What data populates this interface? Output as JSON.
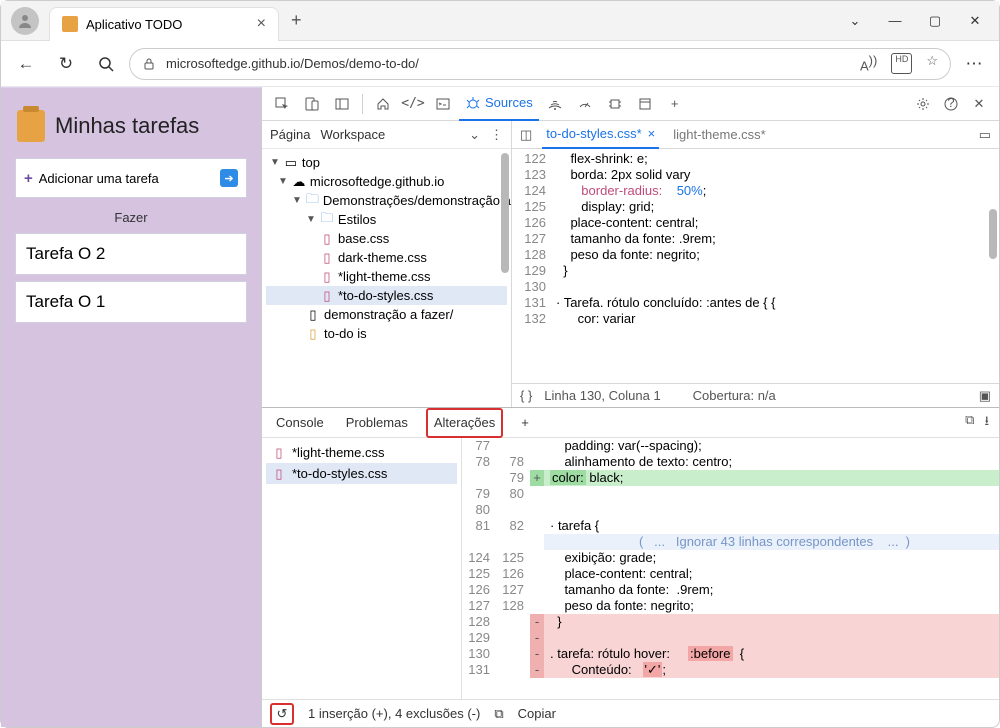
{
  "tab_title": "Aplicativo TODO",
  "url": "microsoftedge.github.io/Demos/demo-to-do/",
  "app": {
    "title": "Minhas tarefas",
    "add_label": "Adicionar uma tarefa",
    "section": "Fazer",
    "tasks": [
      "Tarefa O 2",
      "Tarefa O 1"
    ]
  },
  "dt": {
    "sources_label": "Sources",
    "left_tabs": {
      "pagina": "Página",
      "workspace": "Workspace"
    },
    "tree": {
      "top": "top",
      "domain": "microsoftedge.github.io",
      "demos": "Demonstrações/demonstração a fazer",
      "estilos": "Estilos",
      "files": [
        "base.css",
        "dark-theme.css",
        "*light-theme.css",
        "*to-do-styles.css"
      ],
      "demo2": "demonstração a fazer/",
      "todojs": "to-do is"
    },
    "open_tabs": [
      "to-do-styles.css*",
      "light-theme.css*"
    ],
    "editor_lines": [
      {
        "n": "122",
        "t": "    flex-shrink: e;"
      },
      {
        "n": "123",
        "t": "    borda: 2px solid vary"
      },
      {
        "n": "124",
        "t": "       border-radius:    50%;"
      },
      {
        "n": "125",
        "t": "       display: grid;"
      },
      {
        "n": "126",
        "t": "    place-content: central;"
      },
      {
        "n": "127",
        "t": "    tamanho da fonte: .9rem;"
      },
      {
        "n": "128",
        "t": "    peso da fonte: negrito;"
      },
      {
        "n": "129",
        "t": "  }"
      },
      {
        "n": "130",
        "t": ""
      },
      {
        "n": "131",
        "t": "· Tarefa. rótulo concluído: :antes de { {"
      },
      {
        "n": "132",
        "t": "      cor: variar"
      }
    ],
    "status": {
      "braces": "{ }",
      "pos": "Linha 130, Coluna 1",
      "cov": "Cobertura: n/a"
    },
    "drawer_tabs": {
      "console": "Console",
      "problemas": "Problemas",
      "alteracoes": "Alterações"
    },
    "drawer_files": [
      "*light-theme.css",
      "*to-do-styles.css"
    ],
    "diff": [
      {
        "l": "77",
        "r": "",
        "s": "",
        "t": "    padding: var(--spacing);",
        "cls": ""
      },
      {
        "l": "78",
        "r": "78",
        "s": "",
        "t": "    alinhamento de texto: centro;",
        "cls": ""
      },
      {
        "l": "",
        "r": "79",
        "s": "+",
        "t": "    color: black;",
        "cls": "addline"
      },
      {
        "l": "79",
        "r": "80",
        "s": "",
        "t": "",
        "cls": ""
      },
      {
        "l": "80",
        "r": "",
        "s": "",
        "t": "",
        "cls": ""
      },
      {
        "l": "81",
        "r": "82",
        "s": "",
        "t": "· tarefa {",
        "cls": ""
      },
      {
        "l": "",
        "r": "",
        "s": "",
        "t": "(   ...   Ignorar 43 linhas correspondentes    ...  )",
        "cls": "hunk"
      },
      {
        "l": "124",
        "r": "125",
        "s": "",
        "t": "    exibição: grade;",
        "cls": ""
      },
      {
        "l": "125",
        "r": "126",
        "s": "",
        "t": "    place-content: central;",
        "cls": ""
      },
      {
        "l": "126",
        "r": "127",
        "s": "",
        "t": "    tamanho da fonte:  .9rem;",
        "cls": ""
      },
      {
        "l": "127",
        "r": "128",
        "s": "",
        "t": "    peso da fonte: negrito;",
        "cls": ""
      },
      {
        "l": "128",
        "r": "",
        "s": "-",
        "t": "  }",
        "cls": "delline"
      },
      {
        "l": "129",
        "r": "",
        "s": "-",
        "t": "",
        "cls": "delline"
      },
      {
        "l": "130",
        "r": "",
        "s": "-",
        "t": ". tarefa: rótulo hover:     :before  {",
        "cls": "delline"
      },
      {
        "l": "131",
        "r": "",
        "s": "-",
        "t": "      Conteúdo:   '✓';",
        "cls": "delline"
      }
    ],
    "drawer_status": {
      "summary": "1 inserção (+), 4 exclusões (-)",
      "copy": "Copiar"
    }
  }
}
